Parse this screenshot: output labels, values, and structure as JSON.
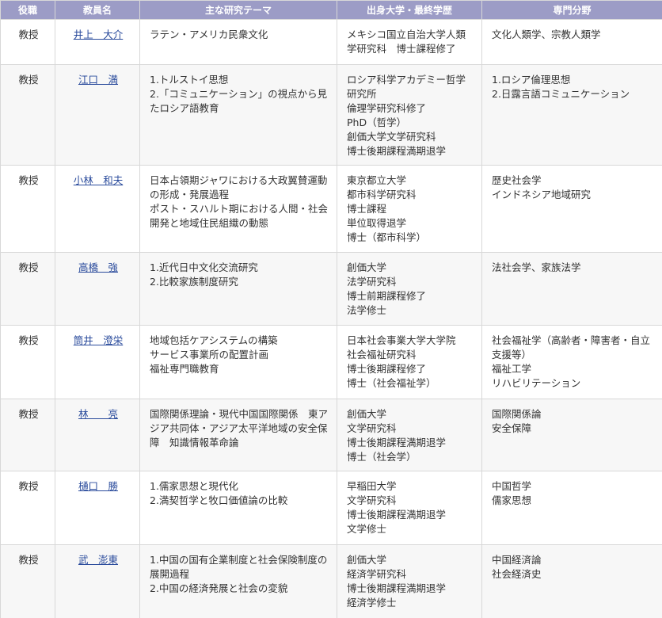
{
  "headers": {
    "rank": "役職",
    "name": "教員名",
    "theme": "主な研究テーマ",
    "education": "出身大学・最終学歴",
    "field": "専門分野"
  },
  "rows": [
    {
      "rank": "教授",
      "name": "井上　大介",
      "theme": [
        "ラテン・アメリカ民衆文化"
      ],
      "education": [
        "メキシコ国立自治大学人類学研究科　博士課程修了"
      ],
      "field": [
        "文化人類学、宗教人類学"
      ]
    },
    {
      "rank": "教授",
      "name": "江口　満",
      "theme": [
        "1.トルストイ思想",
        "2.「コミュニケーション」の視点から見たロシア語教育"
      ],
      "education": [
        "ロシア科学アカデミー哲学研究所",
        "倫理学研究科修了",
        "PhD（哲学）",
        "創価大学文学研究科",
        "博士後期課程満期退学"
      ],
      "field": [
        "1.ロシア倫理思想",
        "2.日露言語コミュニケーション"
      ]
    },
    {
      "rank": "教授",
      "name": "小林　和夫",
      "theme": [
        "日本占領期ジャワにおける大政翼賛運動の形成・発展過程",
        "ポスト・スハルト期における人間・社会開発と地域住民組織の動態"
      ],
      "education": [
        "東京都立大学",
        "都市科学研究科",
        "博士課程",
        "単位取得退学",
        "博士（都市科学）"
      ],
      "field": [
        "歴史社会学",
        "インドネシア地域研究"
      ]
    },
    {
      "rank": "教授",
      "name": "高橋　強",
      "theme": [
        "1.近代日中文化交流研究",
        "2.比較家族制度研究"
      ],
      "education": [
        "創価大学",
        "法学研究科",
        "博士前期課程修了",
        "法学修士"
      ],
      "field": [
        "法社会学、家族法学"
      ]
    },
    {
      "rank": "教授",
      "name": "筒井　澄栄",
      "theme": [
        "地域包括ケアシステムの構築",
        "サービス事業所の配置計画",
        "福祉専門職教育"
      ],
      "education": [
        "日本社会事業大学大学院",
        "社会福祉研究科",
        "博士後期課程修了",
        "博士（社会福祉学）"
      ],
      "field": [
        "社会福祉学（高齢者・障害者・自立支援等）",
        "福祉工学",
        "リハビリテーション"
      ]
    },
    {
      "rank": "教授",
      "name": "林　　亮",
      "theme": [
        "国際関係理論・現代中国国際関係　東アジア共同体・アジア太平洋地域の安全保障　知識情報革命論"
      ],
      "education": [
        "創価大学",
        "文学研究科",
        "博士後期課程満期退学",
        "博士（社会学）"
      ],
      "field": [
        "国際関係論",
        "安全保障"
      ]
    },
    {
      "rank": "教授",
      "name": "樋口　勝",
      "theme": [
        "1.儒家思想と現代化",
        "2.満契哲学と牧口価値論の比較"
      ],
      "education": [
        "早稲田大学",
        "文学研究科",
        "博士後期課程満期退学",
        "文学修士"
      ],
      "field": [
        "中国哲学",
        "儒家思想"
      ]
    },
    {
      "rank": "教授",
      "name": "武　澎東",
      "theme": [
        "1.中国の国有企業制度と社会保険制度の展開過程",
        "2.中国の経済発展と社会の変貌"
      ],
      "education": [
        "創価大学",
        "経済学研究科",
        "博士後期課程満期退学",
        "経済学修士"
      ],
      "field": [
        "中国経済論",
        "社会経済史"
      ]
    }
  ]
}
